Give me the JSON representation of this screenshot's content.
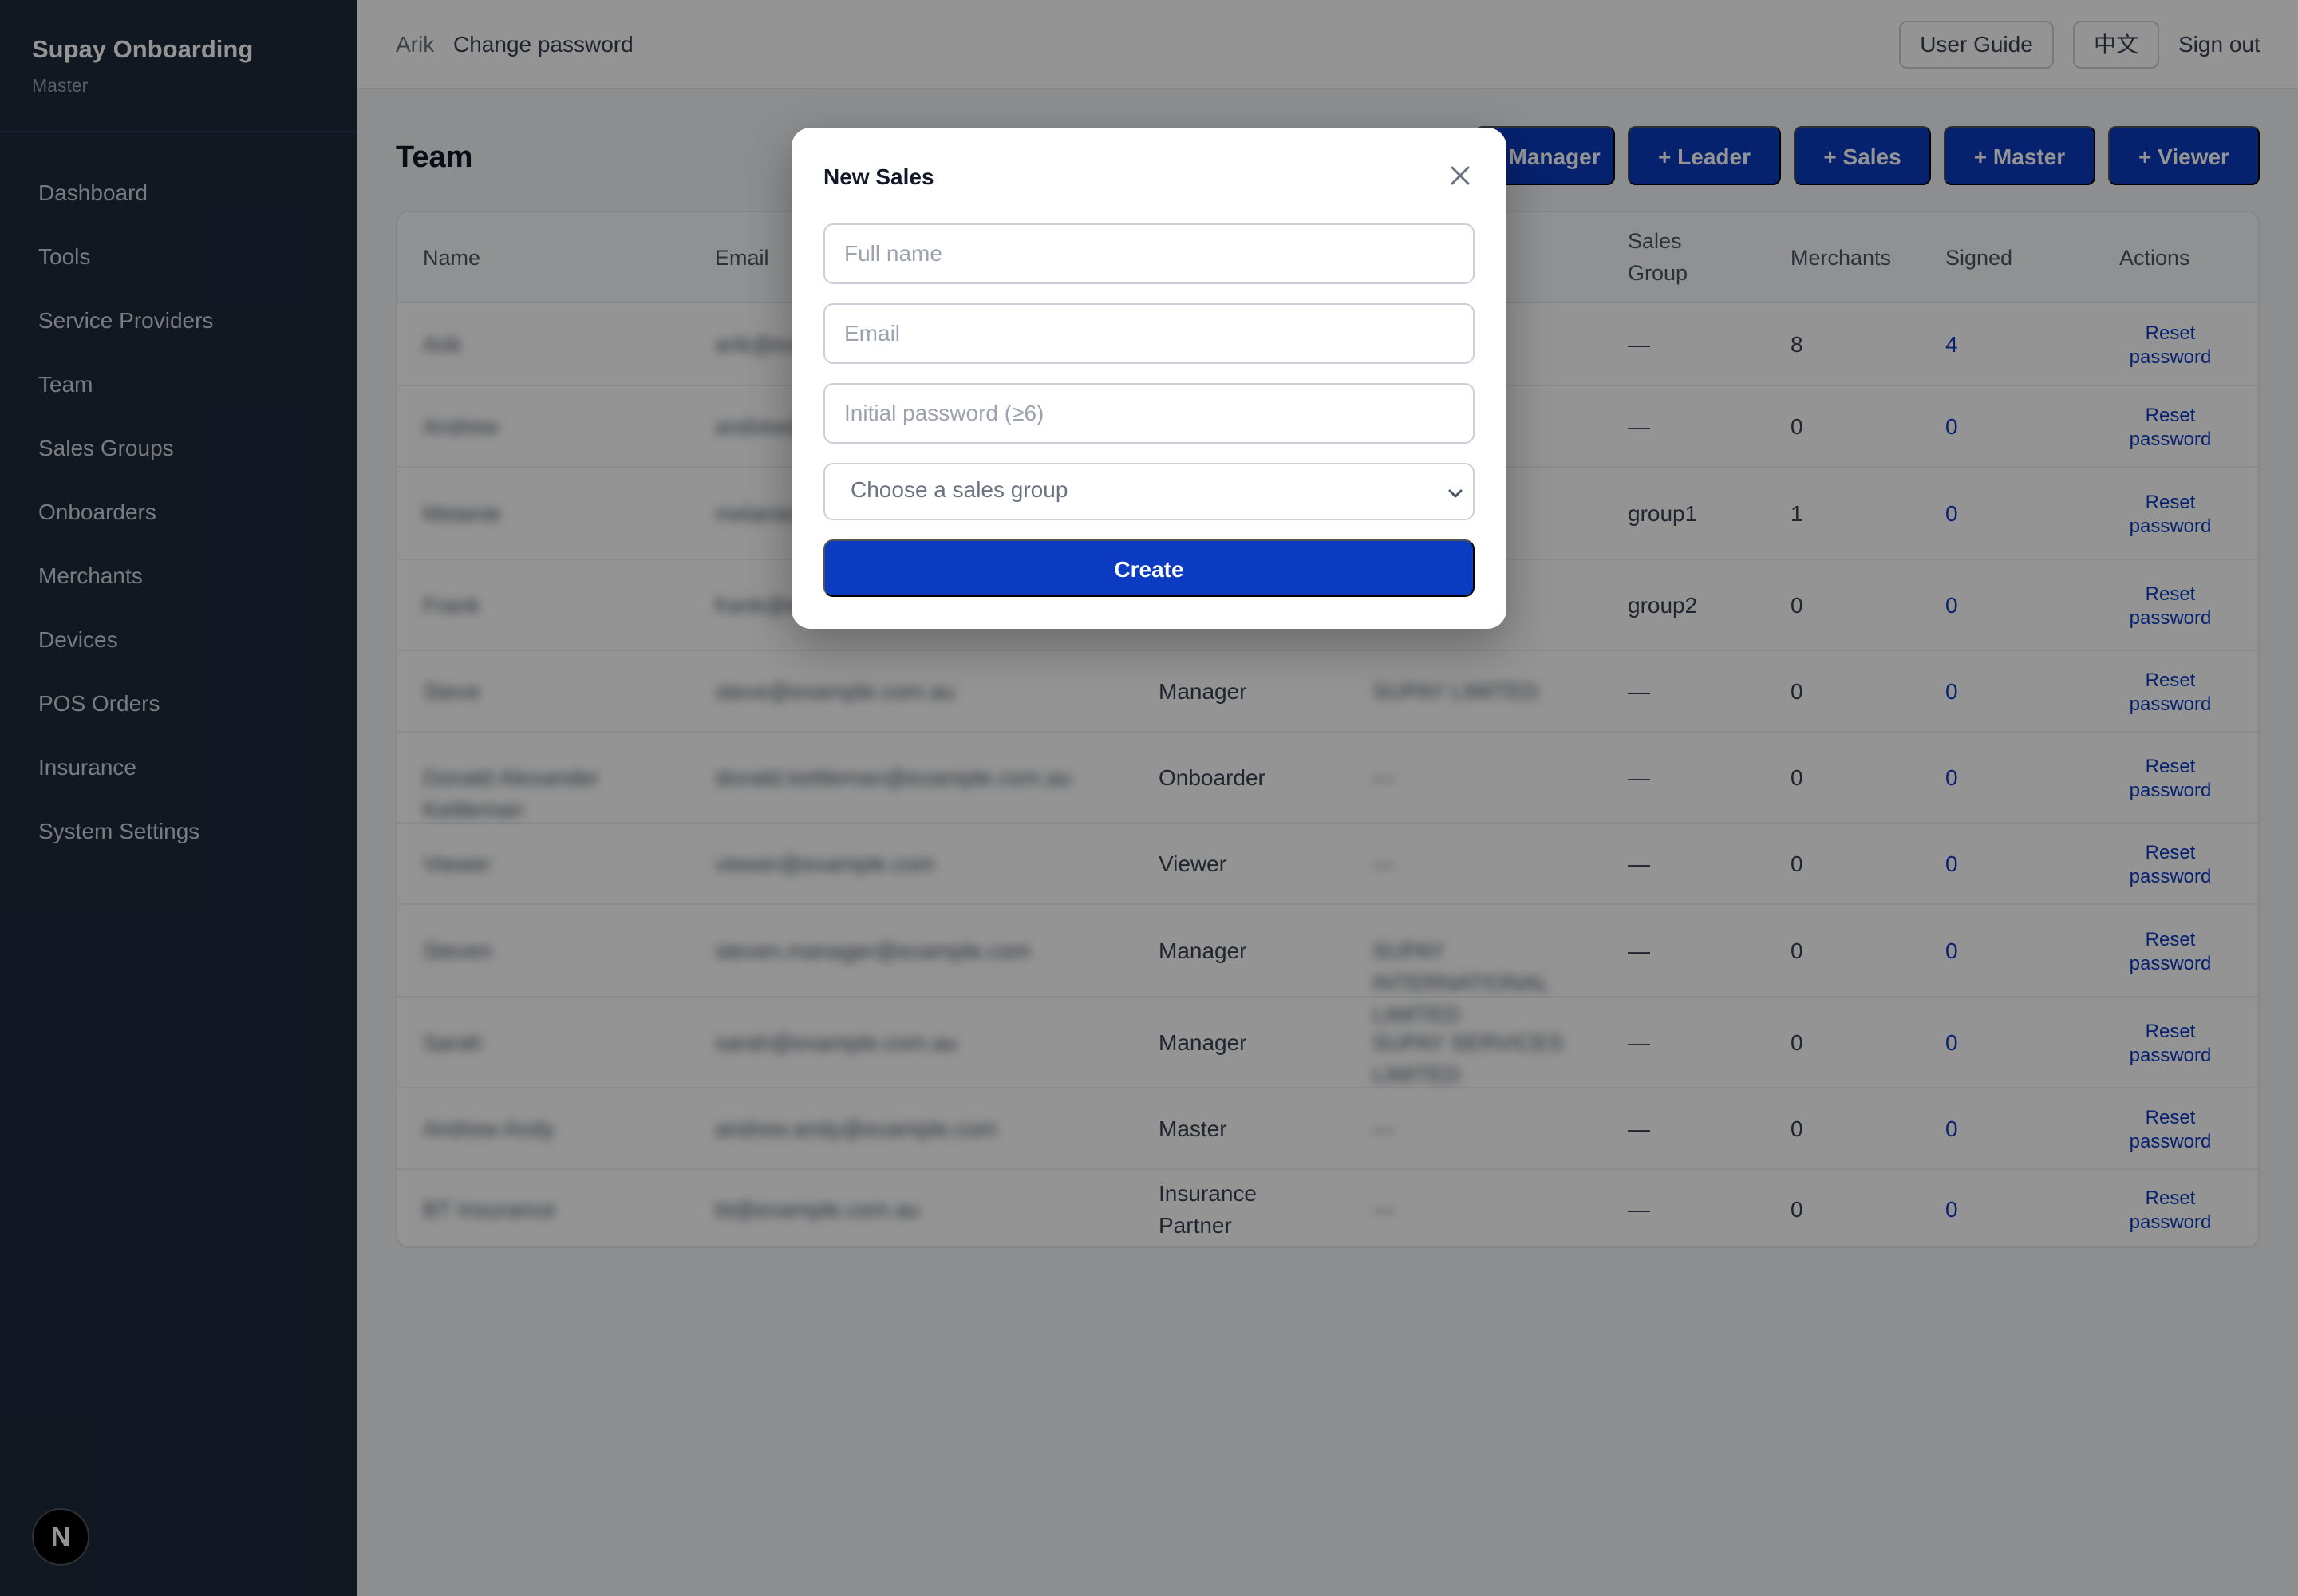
{
  "brand": {
    "title": "Supay Onboarding",
    "role": "Master"
  },
  "sidebar": {
    "items": [
      {
        "label": "Dashboard"
      },
      {
        "label": "Tools"
      },
      {
        "label": "Service Providers"
      },
      {
        "label": "Team"
      },
      {
        "label": "Sales Groups"
      },
      {
        "label": "Onboarders"
      },
      {
        "label": "Merchants"
      },
      {
        "label": "Devices"
      },
      {
        "label": "POS Orders"
      },
      {
        "label": "Insurance"
      },
      {
        "label": "System Settings"
      }
    ],
    "badge": "N"
  },
  "topbar": {
    "user": "Arik",
    "change_password": "Change password",
    "user_guide": "User Guide",
    "language": "中文",
    "sign_out": "Sign out"
  },
  "page": {
    "title": "Team",
    "add_buttons": [
      "+ Manager",
      "+ Leader",
      "+ Sales",
      "+ Master",
      "+ Viewer"
    ]
  },
  "table": {
    "columns": {
      "name": "Name",
      "email": "Email",
      "sales_group_line1": "Sales",
      "sales_group_line2": "Group",
      "merchants": "Merchants",
      "signed": "Signed",
      "actions": "Actions"
    },
    "reset_line1": "Reset",
    "reset_line2": "password",
    "rows": [
      {
        "name": "Arik",
        "email": "arik@example.com",
        "role": "",
        "scope": "",
        "group": "—",
        "merchants": "8",
        "signed": "4"
      },
      {
        "name": "Andrew",
        "email": "andrew@example.com",
        "role": "",
        "scope": "",
        "group": "—",
        "merchants": "0",
        "signed": "0"
      },
      {
        "name": "Melanie",
        "email": "melanie@example.com",
        "role": "",
        "scope": "",
        "group": "group1",
        "merchants": "1",
        "signed": "0"
      },
      {
        "name": "Frank",
        "email": "frank@example.com",
        "role": "",
        "scope": "",
        "group": "group2",
        "merchants": "0",
        "signed": "0"
      },
      {
        "name": "Steve",
        "email": "steve@example.com.au",
        "role": "Manager",
        "scope": "SUPAY LIMITED",
        "group": "—",
        "merchants": "0",
        "signed": "0"
      },
      {
        "name": "Donald Alexander Kettleman",
        "email": "donald.kettleman@example.com.au",
        "role": "Onboarder",
        "scope": "—",
        "group": "—",
        "merchants": "0",
        "signed": "0"
      },
      {
        "name": "Viewer",
        "email": "viewer@example.com",
        "role": "Viewer",
        "scope": "—",
        "group": "—",
        "merchants": "0",
        "signed": "0"
      },
      {
        "name": "Steven",
        "email": "steven.manager@example.com",
        "role": "Manager",
        "scope": "SUPAY INTERNATIONAL LIMITED",
        "group": "—",
        "merchants": "0",
        "signed": "0"
      },
      {
        "name": "Sarah",
        "email": "sarah@example.com.au",
        "role": "Manager",
        "scope": "SUPAY SERVICES LIMITED",
        "group": "—",
        "merchants": "0",
        "signed": "0"
      },
      {
        "name": "Andrew Andy",
        "email": "andrew.andy@example.com",
        "role": "Master",
        "scope": "—",
        "group": "—",
        "merchants": "0",
        "signed": "0"
      },
      {
        "name": "BT Insurance",
        "email": "bt@example.com.au",
        "role_line1": "Insurance",
        "role_line2": "Partner",
        "scope": "—",
        "group": "—",
        "merchants": "0",
        "signed": "0"
      }
    ]
  },
  "modal": {
    "title": "New Sales",
    "fullname_placeholder": "Full name",
    "email_placeholder": "Email",
    "password_placeholder": "Initial password (≥6)",
    "sales_group_placeholder": "Choose a sales group",
    "create_label": "Create"
  },
  "colors": {
    "sidebar": "#1f2a3c",
    "primary": "#0b3bc0",
    "overlay": "rgba(0,0,0,0.42)"
  }
}
